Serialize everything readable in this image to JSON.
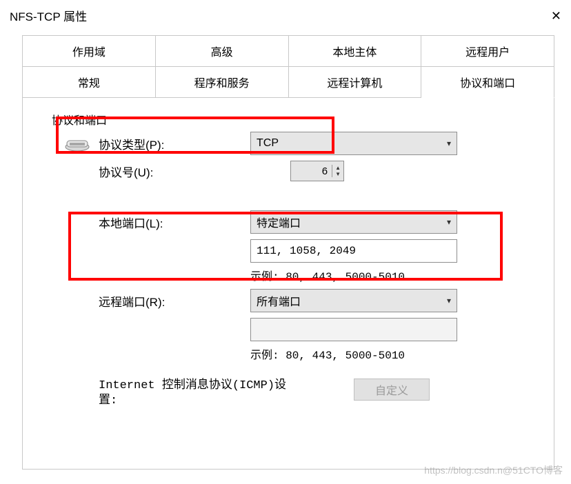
{
  "window": {
    "title": "NFS-TCP 属性"
  },
  "tabs_top": [
    "作用域",
    "高级",
    "本地主体",
    "远程用户"
  ],
  "tabs_bottom": [
    "常规",
    "程序和服务",
    "远程计算机",
    "协议和端口"
  ],
  "active_tab_bottom": 3,
  "group": {
    "title": "协议和端口"
  },
  "fields": {
    "protocol_type": {
      "label": "协议类型(P):",
      "value": "TCP"
    },
    "protocol_number": {
      "label": "协议号(U):",
      "value": "6"
    },
    "local_port": {
      "label": "本地端口(L):",
      "select": "特定端口",
      "value": "111, 1058, 2049",
      "example": "示例: 80, 443, 5000-5010"
    },
    "remote_port": {
      "label": "远程端口(R):",
      "select": "所有端口",
      "value": "",
      "example": "示例: 80, 443, 5000-5010"
    },
    "icmp": {
      "label": "Internet 控制消息协议(ICMP)设置:",
      "button": "自定义"
    }
  },
  "watermark": "https://blog.csdn.n@51CTO博客"
}
